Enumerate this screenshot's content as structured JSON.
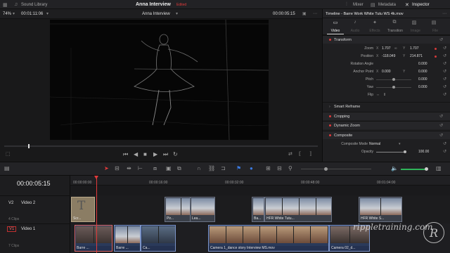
{
  "topbar": {
    "media_pool": "Media Pool",
    "sound_library": "Sound Library",
    "project_title": "Anna Interview",
    "project_status": "Edited",
    "mixer": "Mixer",
    "metadata": "Metadata",
    "inspector": "Inspector"
  },
  "viewer": {
    "zoom": "74%",
    "source_timecode": "00:01:11:06",
    "clip_name": "Anna Interview",
    "timecode": "00:00:05:15"
  },
  "inspector": {
    "title": "Timeline - Barre Work White Tutu WS 4k.mov",
    "tabs": [
      "Video",
      "Audio",
      "Effects",
      "Transition",
      "Image",
      "File"
    ],
    "active_tab": "Video",
    "sections": {
      "transform": "Transform",
      "smart_reframe": "Smart Reframe",
      "cropping": "Cropping",
      "dynamic_zoom": "Dynamic Zoom",
      "composite": "Composite"
    },
    "zoom": {
      "label": "Zoom",
      "x_label": "X",
      "x": "1.707",
      "y_label": "Y",
      "y": "1.707"
    },
    "position": {
      "label": "Position",
      "x_label": "X",
      "x": "-118.049",
      "y_label": "Y",
      "y": "214.871"
    },
    "rotation": {
      "label": "Rotation Angle",
      "value": "0.000"
    },
    "anchor": {
      "label": "Anchor Point",
      "x_label": "X",
      "x": "0.000",
      "y_label": "Y",
      "y": "0.000"
    },
    "pitch": {
      "label": "Pitch",
      "value": "0.000"
    },
    "yaw": {
      "label": "Yaw",
      "value": "0.000"
    },
    "flip": {
      "label": "Flip"
    },
    "composite_mode": {
      "label": "Composite Mode",
      "value": "Normal"
    },
    "opacity": {
      "label": "Opacity",
      "value": "100.00"
    }
  },
  "timeline": {
    "timecode": "00:00:05:15",
    "ruler": [
      "00:00:00:00",
      "00:00:16:00",
      "00:00:32:00",
      "00:00:48:00",
      "00:01:04:00"
    ],
    "tracks": [
      {
        "id": "V2",
        "name": "Video 2",
        "clips": "4 Clips"
      },
      {
        "id": "V1",
        "name": "Video 1",
        "clips": "7 Clips"
      }
    ],
    "v2_clips": [
      "Scr...",
      "Pir...",
      "Lea...",
      "Ba...",
      "HFR White Tutu...",
      "HFR White S..."
    ],
    "v1_clips": [
      "Barre ...",
      "Barre ...",
      "Ca...",
      "Camera 1_dance story Interview MS.mov",
      "Camera 02_d..."
    ]
  },
  "watermark": "rippletraining.com",
  "colors": {
    "accent": "#e03a3a",
    "playhead": "#e03a3a",
    "clip_blue": "#2a3a5a"
  }
}
